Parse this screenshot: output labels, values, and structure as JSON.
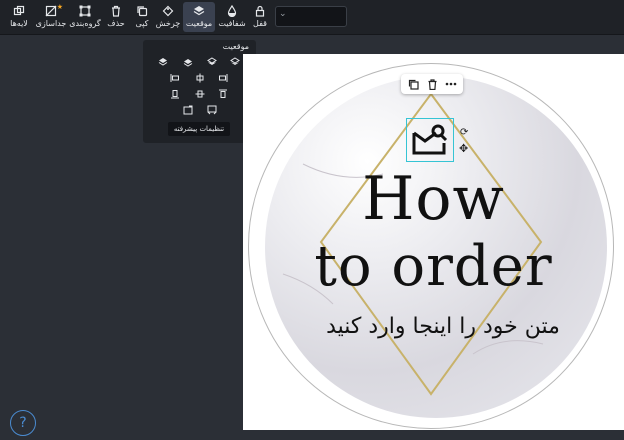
{
  "toolbar": {
    "items": [
      {
        "label": "لایه‌ها",
        "icon": "layers-icon"
      },
      {
        "label": "جداسازی",
        "icon": "detach-icon"
      },
      {
        "label": "گروه‌بندی",
        "icon": "group-icon"
      },
      {
        "label": "حذف",
        "icon": "trash-icon"
      },
      {
        "label": "کپی",
        "icon": "copy-icon"
      },
      {
        "label": "چرخش",
        "icon": "rotate-icon"
      },
      {
        "label": "موقعیت",
        "icon": "position-icon"
      },
      {
        "label": "شفافیت",
        "icon": "opacity-icon"
      },
      {
        "label": "قفل",
        "icon": "lock-icon"
      }
    ],
    "active_item": "موقعیت",
    "accent": "#3a4150"
  },
  "position_panel": {
    "title": "موقعیت",
    "advanced_button": "تنظیمات پیشرفته"
  },
  "canvas": {
    "title_line1": "How",
    "title_line2": "to order",
    "persian_text": "متن خود را اینجا وارد کنید",
    "selection_color": "#35c4d4",
    "diamond_color": "#c8b26a"
  },
  "help": {
    "label": "?"
  }
}
